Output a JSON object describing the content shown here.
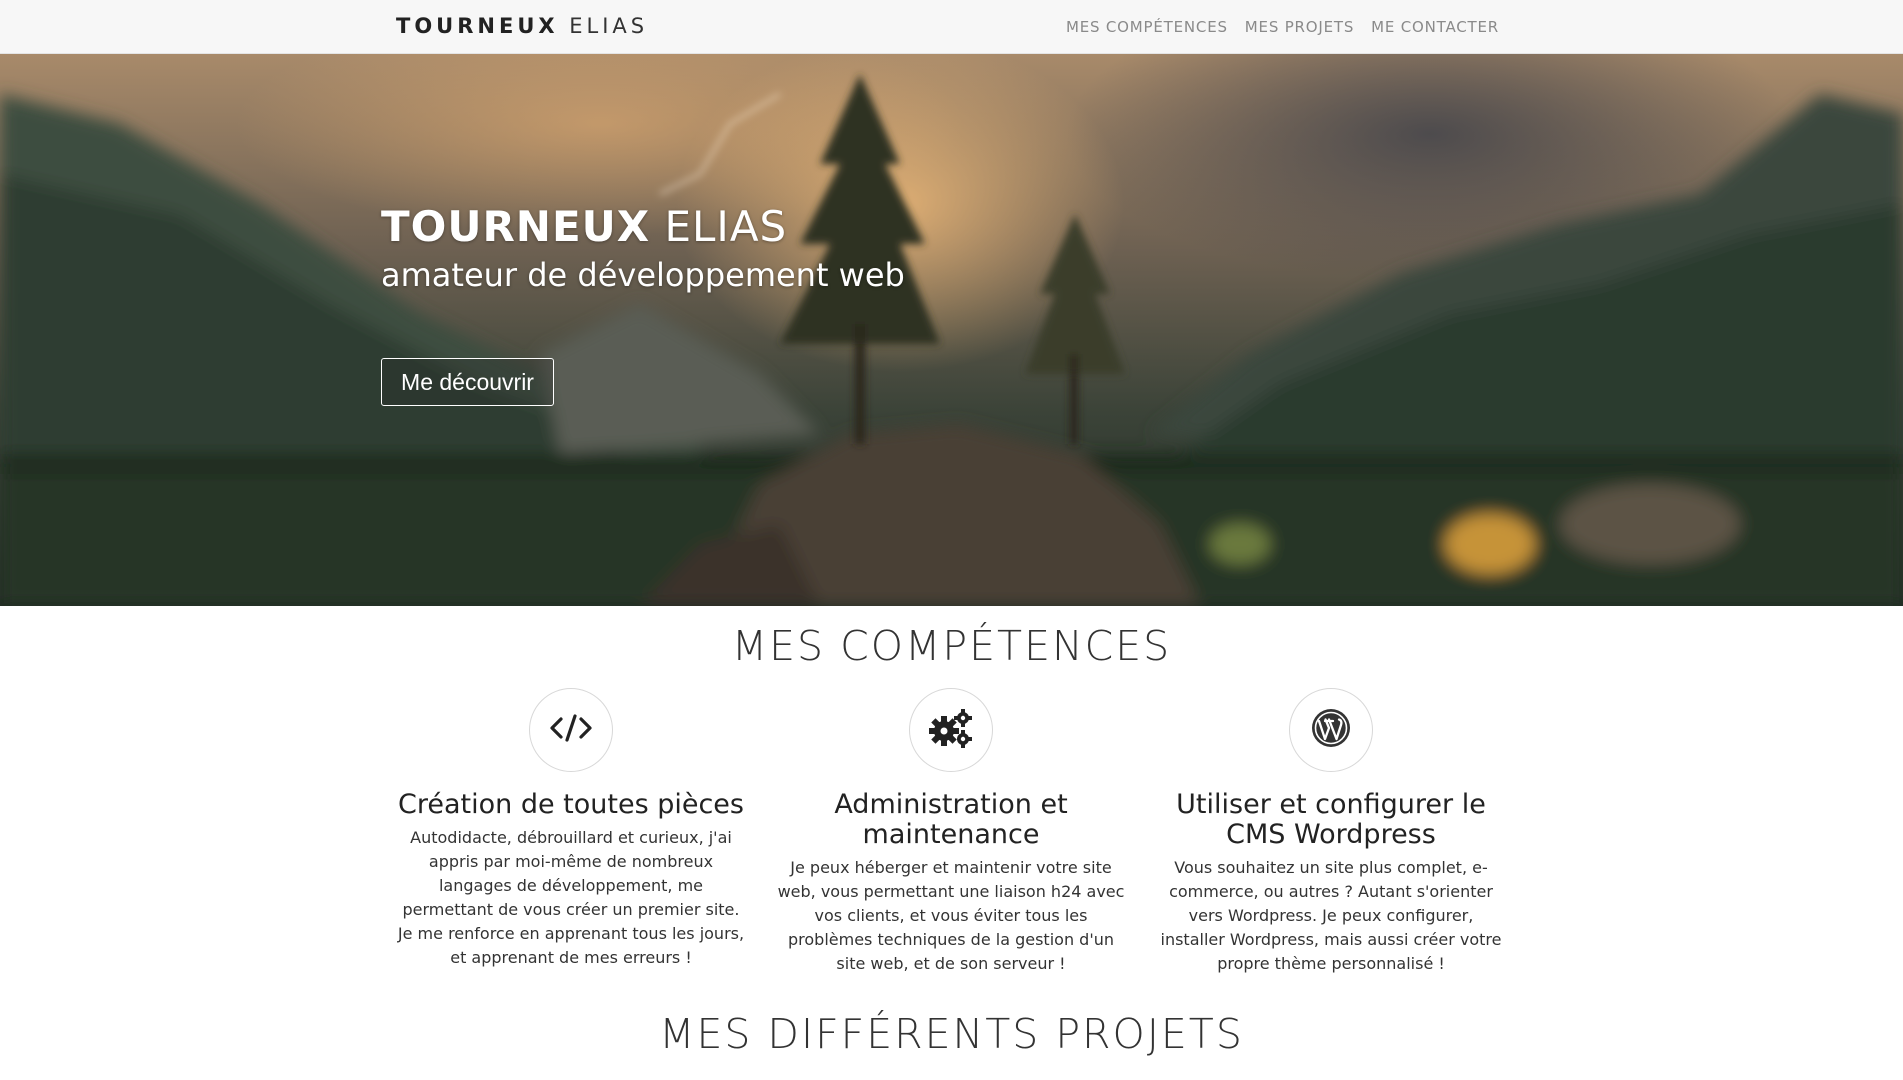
{
  "navbar": {
    "brand_bold": "TOURNEUX",
    "brand_light": "ELIAS",
    "links": [
      {
        "label": "MES COMPÉTENCES"
      },
      {
        "label": "MES PROJETS"
      },
      {
        "label": "ME CONTACTER"
      }
    ]
  },
  "hero": {
    "title_bold": "TOURNEUX",
    "title_light": "ELIAS",
    "subtitle": "amateur de développement web",
    "button_label": "Me découvrir"
  },
  "skills": {
    "title": "MES COMPÉTENCES",
    "items": [
      {
        "icon": "code-icon",
        "title": "Création de toutes pièces",
        "text": "Autodidacte, débrouillard et curieux, j'ai appris par moi-même de nombreux langages de développement, me permettant de vous créer un premier site. Je me renforce en apprenant tous les jours, et apprenant de mes erreurs !"
      },
      {
        "icon": "gears-icon",
        "title": "Administration et maintenance",
        "text": "Je peux héberger et maintenir votre site web, vous permettant une liaison h24 avec vos clients, et vous éviter tous les problèmes techniques de la gestion d'un site web, et de son serveur !"
      },
      {
        "icon": "wordpress-icon",
        "title": "Utiliser et configurer le CMS Wordpress",
        "text": "Vous souhaitez un site plus complet, e-commerce, ou autres ? Autant s'orienter vers Wordpress. Je peux configurer, installer Wordpress, mais aussi créer votre propre thème personnalisé !"
      }
    ]
  },
  "projects": {
    "title": "MES DIFFÉRENTS PROJETS"
  },
  "colors": {
    "navbar_bg": "#f7f7f7",
    "nav_link": "#8a8a8a",
    "text_dark": "#222222"
  }
}
